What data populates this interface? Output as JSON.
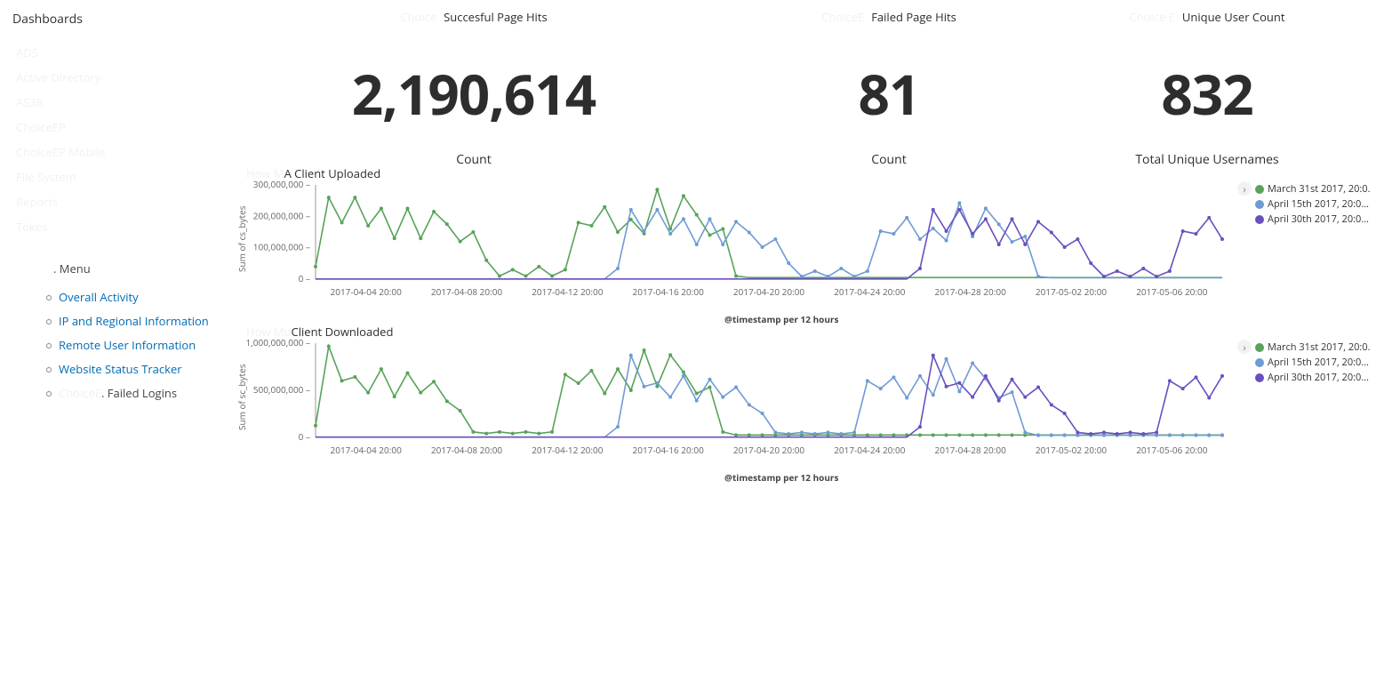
{
  "sidebar": {
    "title": "Dashboards",
    "faded_items": [
      "ADS",
      "Active Directory",
      "AS3R",
      "ChoiceEP",
      "ChoiceEP Mobile",
      "File System",
      "Reports",
      "Tokes"
    ],
    "menu_label": ". Menu",
    "menu": [
      {
        "label": "Overall Activity"
      },
      {
        "label": "IP and Regional Information"
      },
      {
        "label": "Remote User Information"
      },
      {
        "label": "Website Status Tracker"
      },
      {
        "faded_prefix": "ChoiceE",
        "label": ". Failed Logins",
        "faded": true
      }
    ]
  },
  "metrics": {
    "successful": {
      "ghost": "Choice",
      "title": "Succesful Page Hits",
      "value": "2,190,614",
      "sub": "Count"
    },
    "failed": {
      "ghost": "ChoiceE",
      "title": "Failed Page Hits",
      "value": "81",
      "sub": "Count"
    },
    "unique": {
      "ghost": "Choice E",
      "title": "Unique User Count",
      "value": "832",
      "sub": "Total Unique Usernames"
    }
  },
  "charts": {
    "upload": {
      "ghost": "How M",
      "suffix": "A Client Uploaded",
      "ylabel": "Sum of cs_bytes"
    },
    "download": {
      "ghost": "How Mu",
      "suffix": "Client Downloaded",
      "ylabel": "Sum of sc_bytes"
    },
    "xlabel": "@timestamp per 12 hours",
    "legend": [
      {
        "color": "#57a35a",
        "label": "March 31st 2017, 20:0…"
      },
      {
        "color": "#6f9bd4",
        "label": "April 15th 2017, 20:0…"
      },
      {
        "color": "#6b4fbf",
        "label": "April 30th 2017, 20:0…"
      }
    ],
    "x_ticks": [
      "2017-04-04 20:00",
      "2017-04-08 20:00",
      "2017-04-12 20:00",
      "2017-04-16 20:00",
      "2017-04-20 20:00",
      "2017-04-24 20:00",
      "2017-04-28 20:00",
      "2017-05-02 20:00",
      "2017-05-06 20:00"
    ],
    "upload_y_ticks": [
      "0",
      "100,000,000",
      "200,000,000",
      "300,000,000"
    ],
    "download_y_ticks": [
      "0",
      "500,000,000",
      "1,000,000,000"
    ]
  },
  "chart_data": [
    {
      "type": "line",
      "title": "A Client Uploaded",
      "ylabel": "Sum of cs_bytes",
      "xlabel": "@timestamp per 12 hours",
      "ylim": [
        0,
        300000000
      ],
      "x_start": "2017-04-03 08:00",
      "x_step_hours": 12,
      "n_points": 70,
      "series": [
        {
          "name": "March 31st 2017, 20:00",
          "color": "#57a35a",
          "scale": 1.0
        },
        {
          "name": "April 15th 2017, 20:00",
          "color": "#6f9bd4",
          "scale": 0.85
        },
        {
          "name": "April 30th 2017, 20:00",
          "color": "#6b4fbf",
          "scale": 0.85
        }
      ],
      "pattern_millions": [
        40,
        260,
        180,
        260,
        170,
        225,
        130,
        225,
        130,
        215,
        175,
        120,
        150,
        60,
        10,
        30,
        10,
        40,
        10,
        30,
        180,
        170,
        230,
        150,
        190,
        145,
        285,
        160,
        265,
        205,
        140,
        160,
        10,
        5,
        5,
        5,
        5,
        5,
        5,
        5,
        5,
        5,
        5,
        5,
        5,
        5,
        5,
        5,
        5,
        5,
        5,
        5,
        5,
        5,
        5,
        5,
        5,
        5,
        5,
        5,
        5,
        5,
        5,
        5,
        5,
        5,
        5,
        5,
        5,
        5
      ],
      "series_offsets_points": [
        0,
        23,
        46
      ]
    },
    {
      "type": "line",
      "title": "Client Downloaded",
      "ylabel": "Sum of sc_bytes",
      "xlabel": "@timestamp per 12 hours",
      "ylim": [
        0,
        1200000000
      ],
      "x_start": "2017-04-03 08:00",
      "x_step_hours": 12,
      "n_points": 70,
      "series": [
        {
          "name": "March 31st 2017, 20:00",
          "color": "#57a35a",
          "scale": 1.0
        },
        {
          "name": "April 15th 2017, 20:00",
          "color": "#6f9bd4",
          "scale": 0.9
        },
        {
          "name": "April 30th 2017, 20:00",
          "color": "#6b4fbf",
          "scale": 0.9
        }
      ],
      "pattern_millions": [
        150,
        1160,
        720,
        770,
        570,
        870,
        520,
        820,
        570,
        710,
        460,
        340,
        70,
        50,
        70,
        50,
        70,
        50,
        70,
        800,
        690,
        850,
        560,
        870,
        600,
        1110,
        650,
        1050,
        830,
        560,
        640,
        70,
        30,
        30,
        30,
        30,
        30,
        30,
        30,
        30,
        30,
        30,
        30,
        30,
        30,
        30,
        30,
        30,
        30,
        30,
        30,
        30,
        30,
        30,
        30,
        30,
        30,
        30,
        30,
        30,
        30,
        30,
        30,
        30,
        30,
        30,
        30,
        30,
        30,
        30
      ],
      "series_offsets_points": [
        0,
        23,
        46
      ]
    }
  ]
}
